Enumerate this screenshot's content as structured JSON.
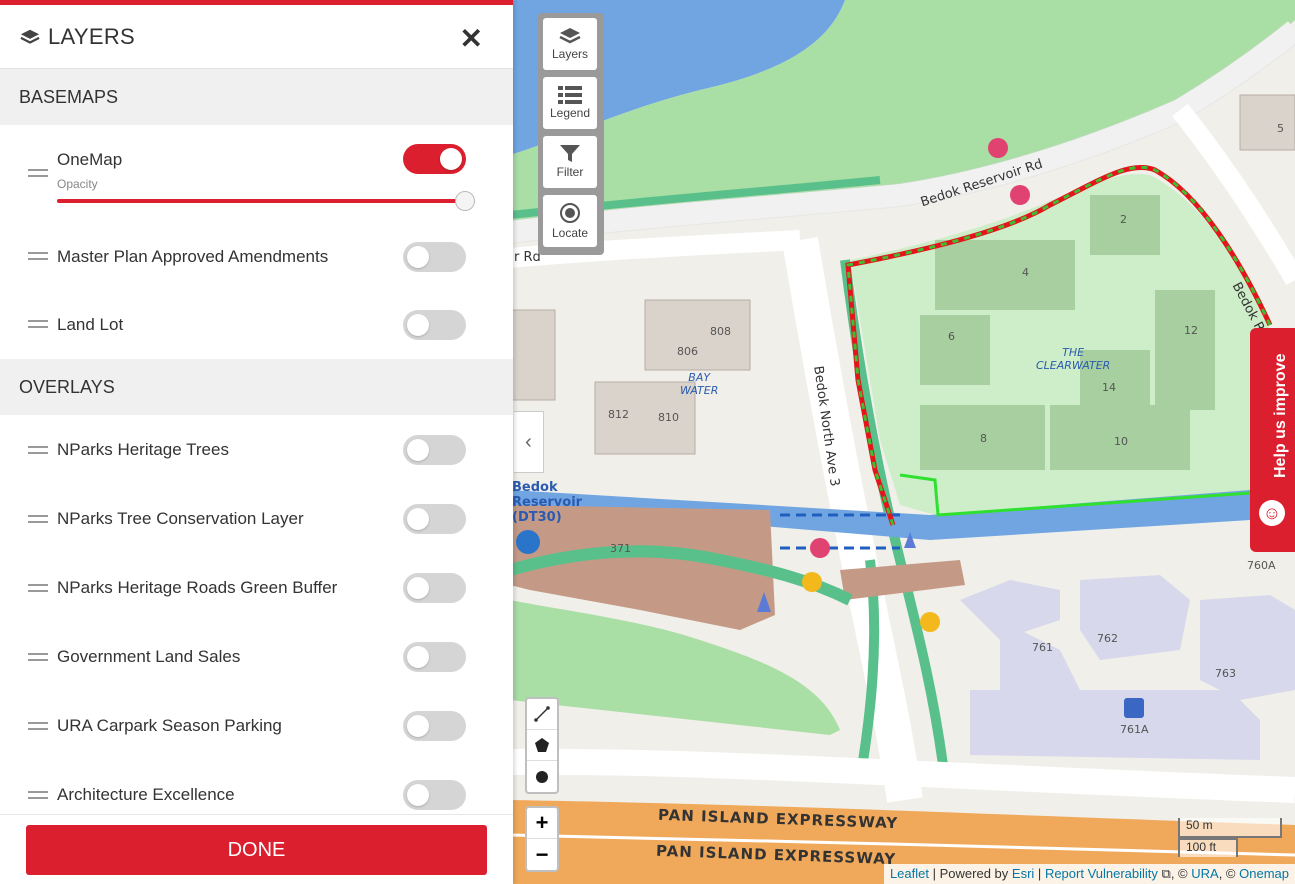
{
  "panel": {
    "title": "LAYERS",
    "basemaps_heading": "BASEMAPS",
    "overlays_heading": "OVERLAYS",
    "opacity_label": "Opacity",
    "opacity_value": 1.0,
    "basemaps": [
      {
        "label": "OneMap",
        "enabled": true
      },
      {
        "label": "Master Plan Approved Amendments",
        "enabled": false
      },
      {
        "label": "Land Lot",
        "enabled": false
      }
    ],
    "overlays": [
      {
        "label": "NParks Heritage Trees",
        "enabled": false
      },
      {
        "label": "NParks Tree Conservation Layer",
        "enabled": false
      },
      {
        "label": "NParks Heritage Roads Green Buffer",
        "enabled": false
      },
      {
        "label": "Government Land Sales",
        "enabled": false
      },
      {
        "label": "URA Carpark Season Parking",
        "enabled": false
      },
      {
        "label": "Architecture Excellence",
        "enabled": false
      }
    ],
    "done_label": "DONE"
  },
  "tools": {
    "layers": "Layers",
    "legend": "Legend",
    "filter": "Filter",
    "locate": "Locate"
  },
  "zoom": {
    "in": "+",
    "out": "−"
  },
  "help_tab": "Help us improve",
  "scale": {
    "metric": "50 m",
    "imperial": "100 ft"
  },
  "attribution": {
    "leaflet": "Leaflet",
    "powered_by": "Powered by",
    "esri": "Esri",
    "report": "Report Vulnerability",
    "sep": "|",
    "copyright": ", © ",
    "ura": "URA",
    "onemap": "Onemap"
  },
  "map": {
    "labels": {
      "road_reservoir": "Bedok Reservoir Rd",
      "road_reservoir_right": "Bedok Res",
      "road_reservoir_left": "r Rd",
      "road_north_ave3": "Bedok North Ave 3",
      "expressway_1": "PAN ISLAND EXPRESSWAY",
      "expressway_2": "PAN ISLAND EXPRESSWAY",
      "bay_water": "BAY\nWATER",
      "clearwater": "THE\nCLEARWATER",
      "station": "Bedok\nReservoir\n(DT30)",
      "blocks": [
        "808",
        "806",
        "812",
        "810",
        "371",
        "2",
        "4",
        "6",
        "8",
        "10",
        "12",
        "14",
        "5",
        "760A",
        "761",
        "762",
        "763",
        "761A"
      ]
    }
  }
}
